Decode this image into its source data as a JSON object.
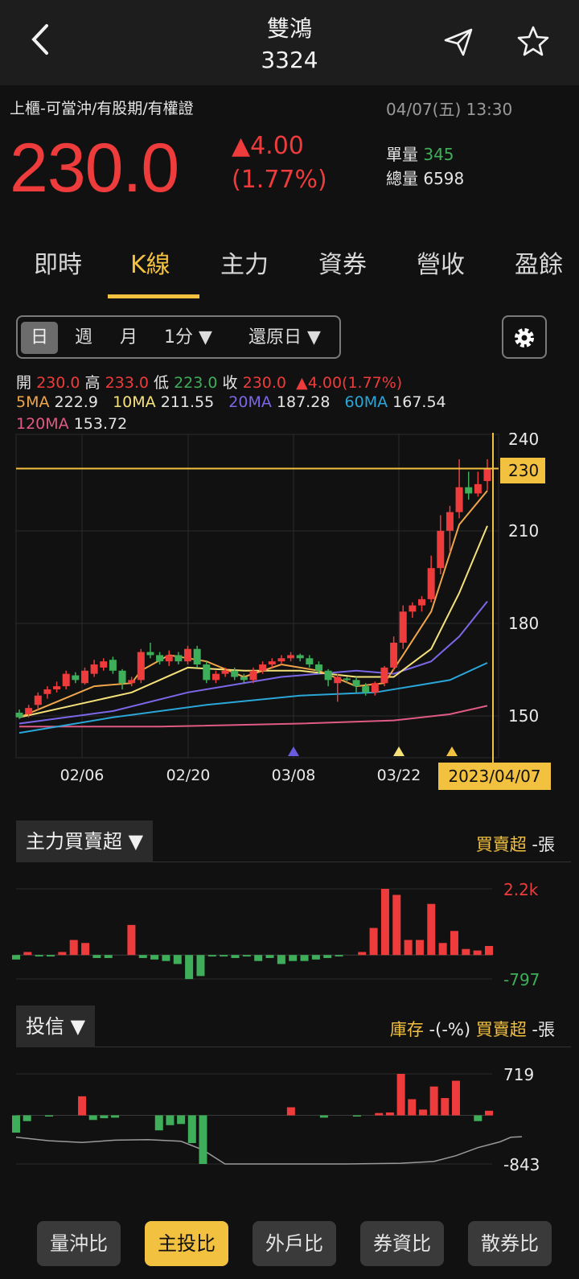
{
  "header": {
    "name": "雙鴻",
    "code": "3324"
  },
  "quote": {
    "tags": "上櫃-可當沖/有股期/有權證",
    "datetime": "04/07(五) 13:30",
    "price": "230.0",
    "change": "▲4.00",
    "change_pct": "(1.77%)",
    "unit_vol_label": "單量",
    "unit_vol": "345",
    "total_vol_label": "總量",
    "total_vol": "6598"
  },
  "tabs": [
    "即時",
    "K線",
    "主力",
    "資券",
    "營收",
    "盈餘"
  ],
  "periods": {
    "day": "日",
    "week": "週",
    "month": "月",
    "minute": "1分",
    "adjust": "還原日"
  },
  "ohlc": {
    "open_label": "開",
    "open": "230.0",
    "high_label": "高",
    "high": "233.0",
    "low_label": "低",
    "low": "223.0",
    "close_label": "收",
    "close": "230.0",
    "change": "▲4.00(1.77%)"
  },
  "ma": {
    "ma5_label": "5MA",
    "ma5": "222.9",
    "ma10_label": "10MA",
    "ma10": "211.55",
    "ma20_label": "20MA",
    "ma20": "187.28",
    "ma60_label": "60MA",
    "ma60": "167.54",
    "ma120_label": "120MA",
    "ma120": "153.72"
  },
  "colors": {
    "up": "#ee3b3b",
    "down": "#3fae5a",
    "ma5": "#f0a64a",
    "ma10": "#f6e27a",
    "ma20": "#7b68e8",
    "ma60": "#2aa6d9",
    "ma120": "#e05a84",
    "accent": "#f3c140"
  },
  "chart_data": [
    {
      "type": "candlestick",
      "title": "",
      "ylim": [
        137,
        241
      ],
      "yticks": [
        "240",
        "210",
        "180",
        "150"
      ],
      "xticks": [
        "02/06",
        "02/20",
        "03/08",
        "03/22"
      ],
      "current_price_label": "230",
      "cursor_date": "2023/04/07",
      "candles": [
        [
          151.5,
          150,
          152.5,
          149.5
        ],
        [
          151,
          153,
          154,
          150
        ],
        [
          154,
          157,
          158,
          152.5
        ],
        [
          157.5,
          159,
          160,
          156
        ],
        [
          159,
          160,
          161.5,
          158
        ],
        [
          160,
          164,
          165,
          159
        ],
        [
          163.5,
          162,
          164.5,
          161
        ],
        [
          161,
          165,
          166,
          160.5
        ],
        [
          164,
          167,
          168.5,
          163
        ],
        [
          166,
          168,
          169,
          165
        ],
        [
          168.5,
          165,
          169.5,
          164
        ],
        [
          165,
          161,
          165.5,
          159
        ],
        [
          161,
          162,
          163,
          160
        ],
        [
          162,
          171,
          172,
          161
        ],
        [
          171,
          170,
          174,
          169
        ],
        [
          170,
          168,
          171,
          167
        ],
        [
          168,
          170,
          171.5,
          166.5
        ],
        [
          170,
          168,
          171,
          167
        ],
        [
          168,
          172,
          173,
          167
        ],
        [
          172,
          167,
          173,
          166
        ],
        [
          167,
          162,
          168,
          161
        ],
        [
          162,
          164,
          165,
          161
        ],
        [
          164,
          165,
          166,
          163
        ],
        [
          165,
          163,
          166,
          162
        ],
        [
          163,
          162,
          164,
          161
        ],
        [
          162,
          165,
          166,
          161
        ],
        [
          165,
          167,
          168,
          164
        ],
        [
          167,
          168,
          169,
          166
        ],
        [
          168,
          169,
          170,
          167
        ],
        [
          169,
          170,
          171,
          168
        ],
        [
          170,
          169,
          170.5,
          168
        ],
        [
          169,
          167,
          170,
          166
        ],
        [
          167,
          165,
          168,
          164
        ],
        [
          165,
          162,
          165.5,
          160
        ],
        [
          161,
          163,
          164,
          155
        ],
        [
          162.5,
          162,
          163,
          161
        ],
        [
          162,
          160,
          163,
          158
        ],
        [
          160,
          158,
          161,
          157
        ],
        [
          158,
          161,
          161.5,
          157
        ],
        [
          161,
          166,
          166.5,
          160
        ],
        [
          166,
          174,
          176,
          165
        ],
        [
          174,
          184,
          186,
          172
        ],
        [
          184,
          186,
          187,
          182
        ],
        [
          186,
          188,
          189,
          184
        ],
        [
          188,
          198,
          202,
          187
        ],
        [
          198,
          210,
          215,
          196
        ],
        [
          210,
          216,
          218,
          203
        ],
        [
          216,
          224,
          233,
          214
        ],
        [
          224,
          222,
          229,
          220
        ],
        [
          222,
          225,
          229,
          221
        ],
        [
          226,
          230,
          233,
          223
        ]
      ],
      "markers": [
        {
          "date": "03/08",
          "color": "#6a5ae0"
        },
        {
          "date": "03/22",
          "color": "#f6e27a"
        },
        {
          "date": "04/07",
          "color": "#f3c140"
        }
      ],
      "series": [
        {
          "name": "5MA",
          "values": [
            [
              0,
              150
            ],
            [
              4,
              155
            ],
            [
              8,
              160
            ],
            [
              12,
              161
            ],
            [
              13,
              165
            ],
            [
              16,
              170
            ],
            [
              20,
              168
            ],
            [
              24,
              163
            ],
            [
              28,
              167
            ],
            [
              32,
              165
            ],
            [
              36,
              160
            ],
            [
              39,
              161
            ],
            [
              41,
              170
            ],
            [
              44,
              184
            ],
            [
              47,
              212
            ],
            [
              50,
              222.9
            ]
          ]
        },
        {
          "name": "10MA",
          "values": [
            [
              0,
              150
            ],
            [
              6,
              154
            ],
            [
              12,
              158
            ],
            [
              18,
              166
            ],
            [
              24,
              165
            ],
            [
              30,
              165
            ],
            [
              36,
              163
            ],
            [
              40,
              163
            ],
            [
              44,
              172
            ],
            [
              47,
              190
            ],
            [
              50,
              211.55
            ]
          ]
        },
        {
          "name": "20MA",
          "values": [
            [
              0,
              148
            ],
            [
              10,
              152
            ],
            [
              18,
              158
            ],
            [
              28,
              163
            ],
            [
              36,
              165
            ],
            [
              40,
              164
            ],
            [
              44,
              168
            ],
            [
              47,
              176
            ],
            [
              50,
              187.28
            ]
          ]
        },
        {
          "name": "60MA",
          "values": [
            [
              0,
              145
            ],
            [
              10,
              150
            ],
            [
              20,
              154
            ],
            [
              30,
              157
            ],
            [
              38,
              158
            ],
            [
              42,
              160
            ],
            [
              46,
              162
            ],
            [
              50,
              167.54
            ]
          ]
        },
        {
          "name": "120MA",
          "values": [
            [
              0,
              147
            ],
            [
              15,
              147
            ],
            [
              30,
              148
            ],
            [
              40,
              149
            ],
            [
              46,
              151
            ],
            [
              50,
              153.72
            ]
          ]
        }
      ]
    },
    {
      "type": "bar",
      "title": "主力買賣超",
      "legend": "買賣超",
      "unit": "-張",
      "ylim": [
        -797,
        2200
      ],
      "yticks": [
        "2.2k",
        "-797"
      ],
      "values": [
        -150,
        100,
        -50,
        -50,
        100,
        500,
        400,
        -100,
        -100,
        0,
        1000,
        -100,
        -150,
        -200,
        -300,
        -800,
        -700,
        -50,
        -50,
        -100,
        -50,
        -200,
        -100,
        -300,
        -200,
        -200,
        -150,
        -100,
        -50,
        0,
        100,
        900,
        2200,
        2000,
        500,
        500,
        1700,
        400,
        800,
        200,
        150,
        300
      ]
    },
    {
      "type": "bar",
      "title": "投信",
      "legend": "買賣超",
      "unit": "-張",
      "inventory_label": "庫存",
      "inventory_value": "-(-%)",
      "ylim": [
        -843,
        719
      ],
      "yticks": [
        "719",
        "-843"
      ],
      "values": [
        -300,
        -100,
        0,
        -20,
        0,
        0,
        330,
        -80,
        -50,
        -40,
        0,
        0,
        0,
        -260,
        -170,
        -150,
        -480,
        -843,
        0,
        0,
        0,
        0,
        0,
        0,
        0,
        140,
        0,
        0,
        -40,
        0,
        0,
        -20,
        0,
        40,
        50,
        719,
        280,
        100,
        500,
        300,
        600,
        0,
        -100,
        80
      ],
      "line": [
        [
          0,
          -380
        ],
        [
          3,
          -440
        ],
        [
          6,
          -470
        ],
        [
          9,
          -430
        ],
        [
          12,
          -420
        ],
        [
          15,
          -450
        ],
        [
          17,
          -600
        ],
        [
          19,
          -843
        ],
        [
          22,
          -843
        ],
        [
          25,
          -843
        ],
        [
          30,
          -843
        ],
        [
          35,
          -830
        ],
        [
          38,
          -800
        ],
        [
          40,
          -700
        ],
        [
          42,
          -560
        ],
        [
          44,
          -460
        ],
        [
          45,
          -380
        ],
        [
          46,
          -370
        ]
      ]
    }
  ],
  "bottom_buttons": [
    "量沖比",
    "主投比",
    "外戶比",
    "券資比",
    "散券比"
  ]
}
